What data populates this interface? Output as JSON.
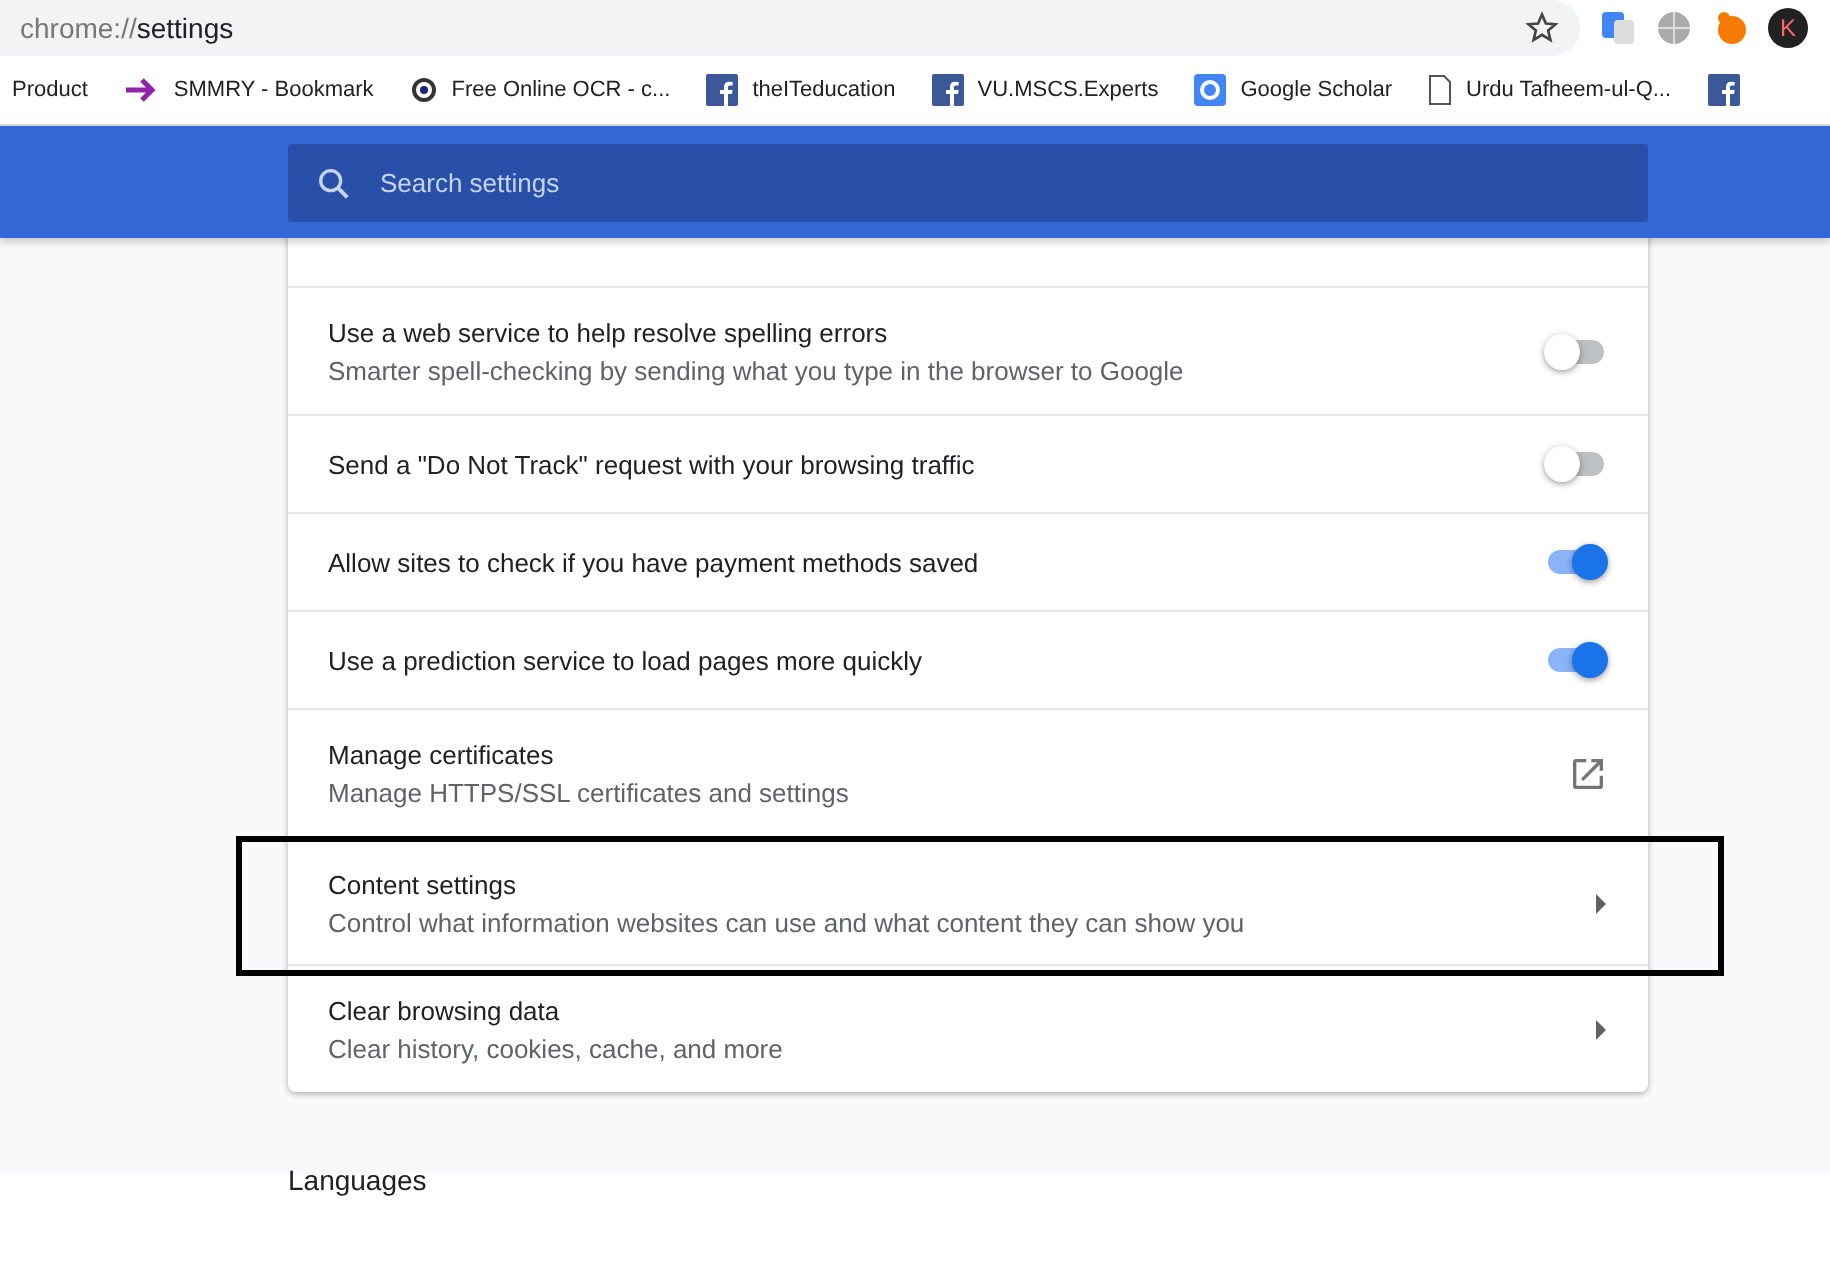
{
  "address_bar": {
    "scheme": "chrome://",
    "path": "settings",
    "profile_initial": "K"
  },
  "bookmarks": [
    {
      "label": "Product"
    },
    {
      "label": "SMMRY - Bookmark"
    },
    {
      "label": "Free Online OCR - c..."
    },
    {
      "label": "theITeducation"
    },
    {
      "label": "VU.MSCS.Experts"
    },
    {
      "label": "Google Scholar"
    },
    {
      "label": "Urdu Tafheem-ul-Q..."
    }
  ],
  "search": {
    "placeholder": "Search settings"
  },
  "settings": [
    {
      "kind": "toggle",
      "title": "Use a web service to help resolve spelling errors",
      "subtitle": "Smarter spell-checking by sending what you type in the browser to Google",
      "on": false,
      "highlighted": false
    },
    {
      "kind": "toggle",
      "title": "Send a \"Do Not Track\" request with your browsing traffic",
      "on": false,
      "highlighted": false
    },
    {
      "kind": "toggle",
      "title": "Allow sites to check if you have payment methods saved",
      "on": true,
      "highlighted": false
    },
    {
      "kind": "toggle",
      "title": "Use a prediction service to load pages more quickly",
      "on": true,
      "highlighted": false
    },
    {
      "kind": "external",
      "title": "Manage certificates",
      "subtitle": "Manage HTTPS/SSL certificates and settings",
      "highlighted": false
    },
    {
      "kind": "arrow",
      "title": "Content settings",
      "subtitle": "Control what information websites can use and what content they can show you",
      "highlighted": true
    },
    {
      "kind": "arrow",
      "title": "Clear browsing data",
      "subtitle": "Clear history, cookies, cache, and more",
      "highlighted": false
    }
  ],
  "next_section": "Languages"
}
